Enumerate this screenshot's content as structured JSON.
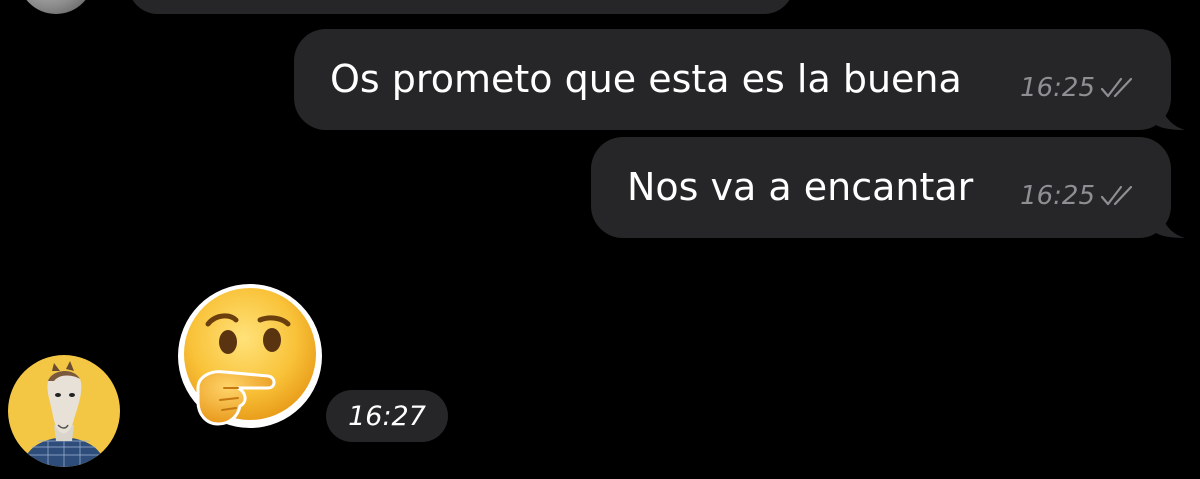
{
  "conversation": {
    "messages": [
      {
        "direction": "outgoing",
        "text": "Os prometo que esta es la buena",
        "time": "16:25",
        "status_icon": "double-check-icon"
      },
      {
        "direction": "outgoing",
        "text": "Nos va a encantar",
        "time": "16:25",
        "status_icon": "double-check-icon"
      },
      {
        "direction": "incoming",
        "sticker": "thinking-face-emoji",
        "time": "16:27"
      }
    ]
  },
  "colors": {
    "background": "#000000",
    "bubble": "#262628",
    "meta_text": "#8e8e93",
    "avatar_bg": "#f3c744"
  }
}
